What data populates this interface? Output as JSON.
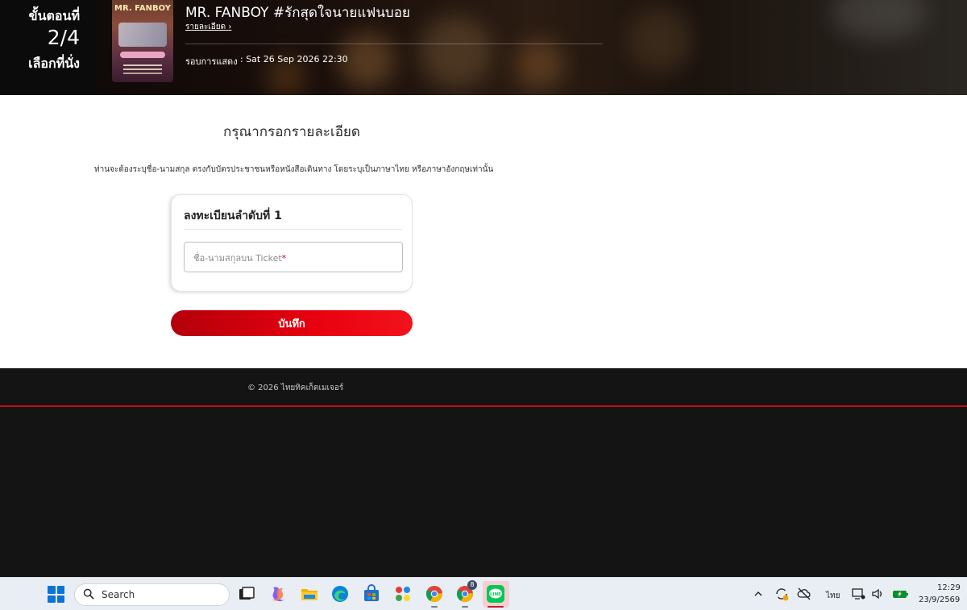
{
  "step": {
    "label": "ขั้นตอนที่",
    "number": "2/4",
    "subtitle": "เลือกที่นั่ง"
  },
  "poster": {
    "title": "MR. FANBOY"
  },
  "event": {
    "title": "MR. FANBOY #รักสุดใจนายแฟนบอย",
    "detail_link": "รายละเอียด",
    "detail_chevron": "›",
    "show_label": "รอบการแสดง",
    "show_value": ": Sat 26 Sep 2026 22:30"
  },
  "form": {
    "heading": "กรุณากรอกรายละเอียด",
    "instruction": "ท่านจะต้องระบุชื่อ-นามสกุล ตรงกับบัตรประชาชนหรือหนังสือเดินทาง โดยระบุเป็นภาษาไทย หรือภาษาอังกฤษเท่านั้น",
    "card_title": "ลงทะเบียนลำดับที่ 1",
    "name_placeholder": "ชื่อ-นามสกุลบน Ticket",
    "required_mark": "*",
    "name_value": "",
    "save_label": "บันทึก"
  },
  "footer": {
    "copyright": "© 2026 ไทยทิคเก็ตเมเจอร์"
  },
  "taskbar": {
    "search_label": "Search",
    "language": "ไทย",
    "time": "12:29",
    "date": "23/9/2569",
    "chrome_badge": "8"
  },
  "colors": {
    "accent_red": "#e8000f",
    "footer_line": "#c40d10",
    "header_dark": "#0b0b0b"
  }
}
